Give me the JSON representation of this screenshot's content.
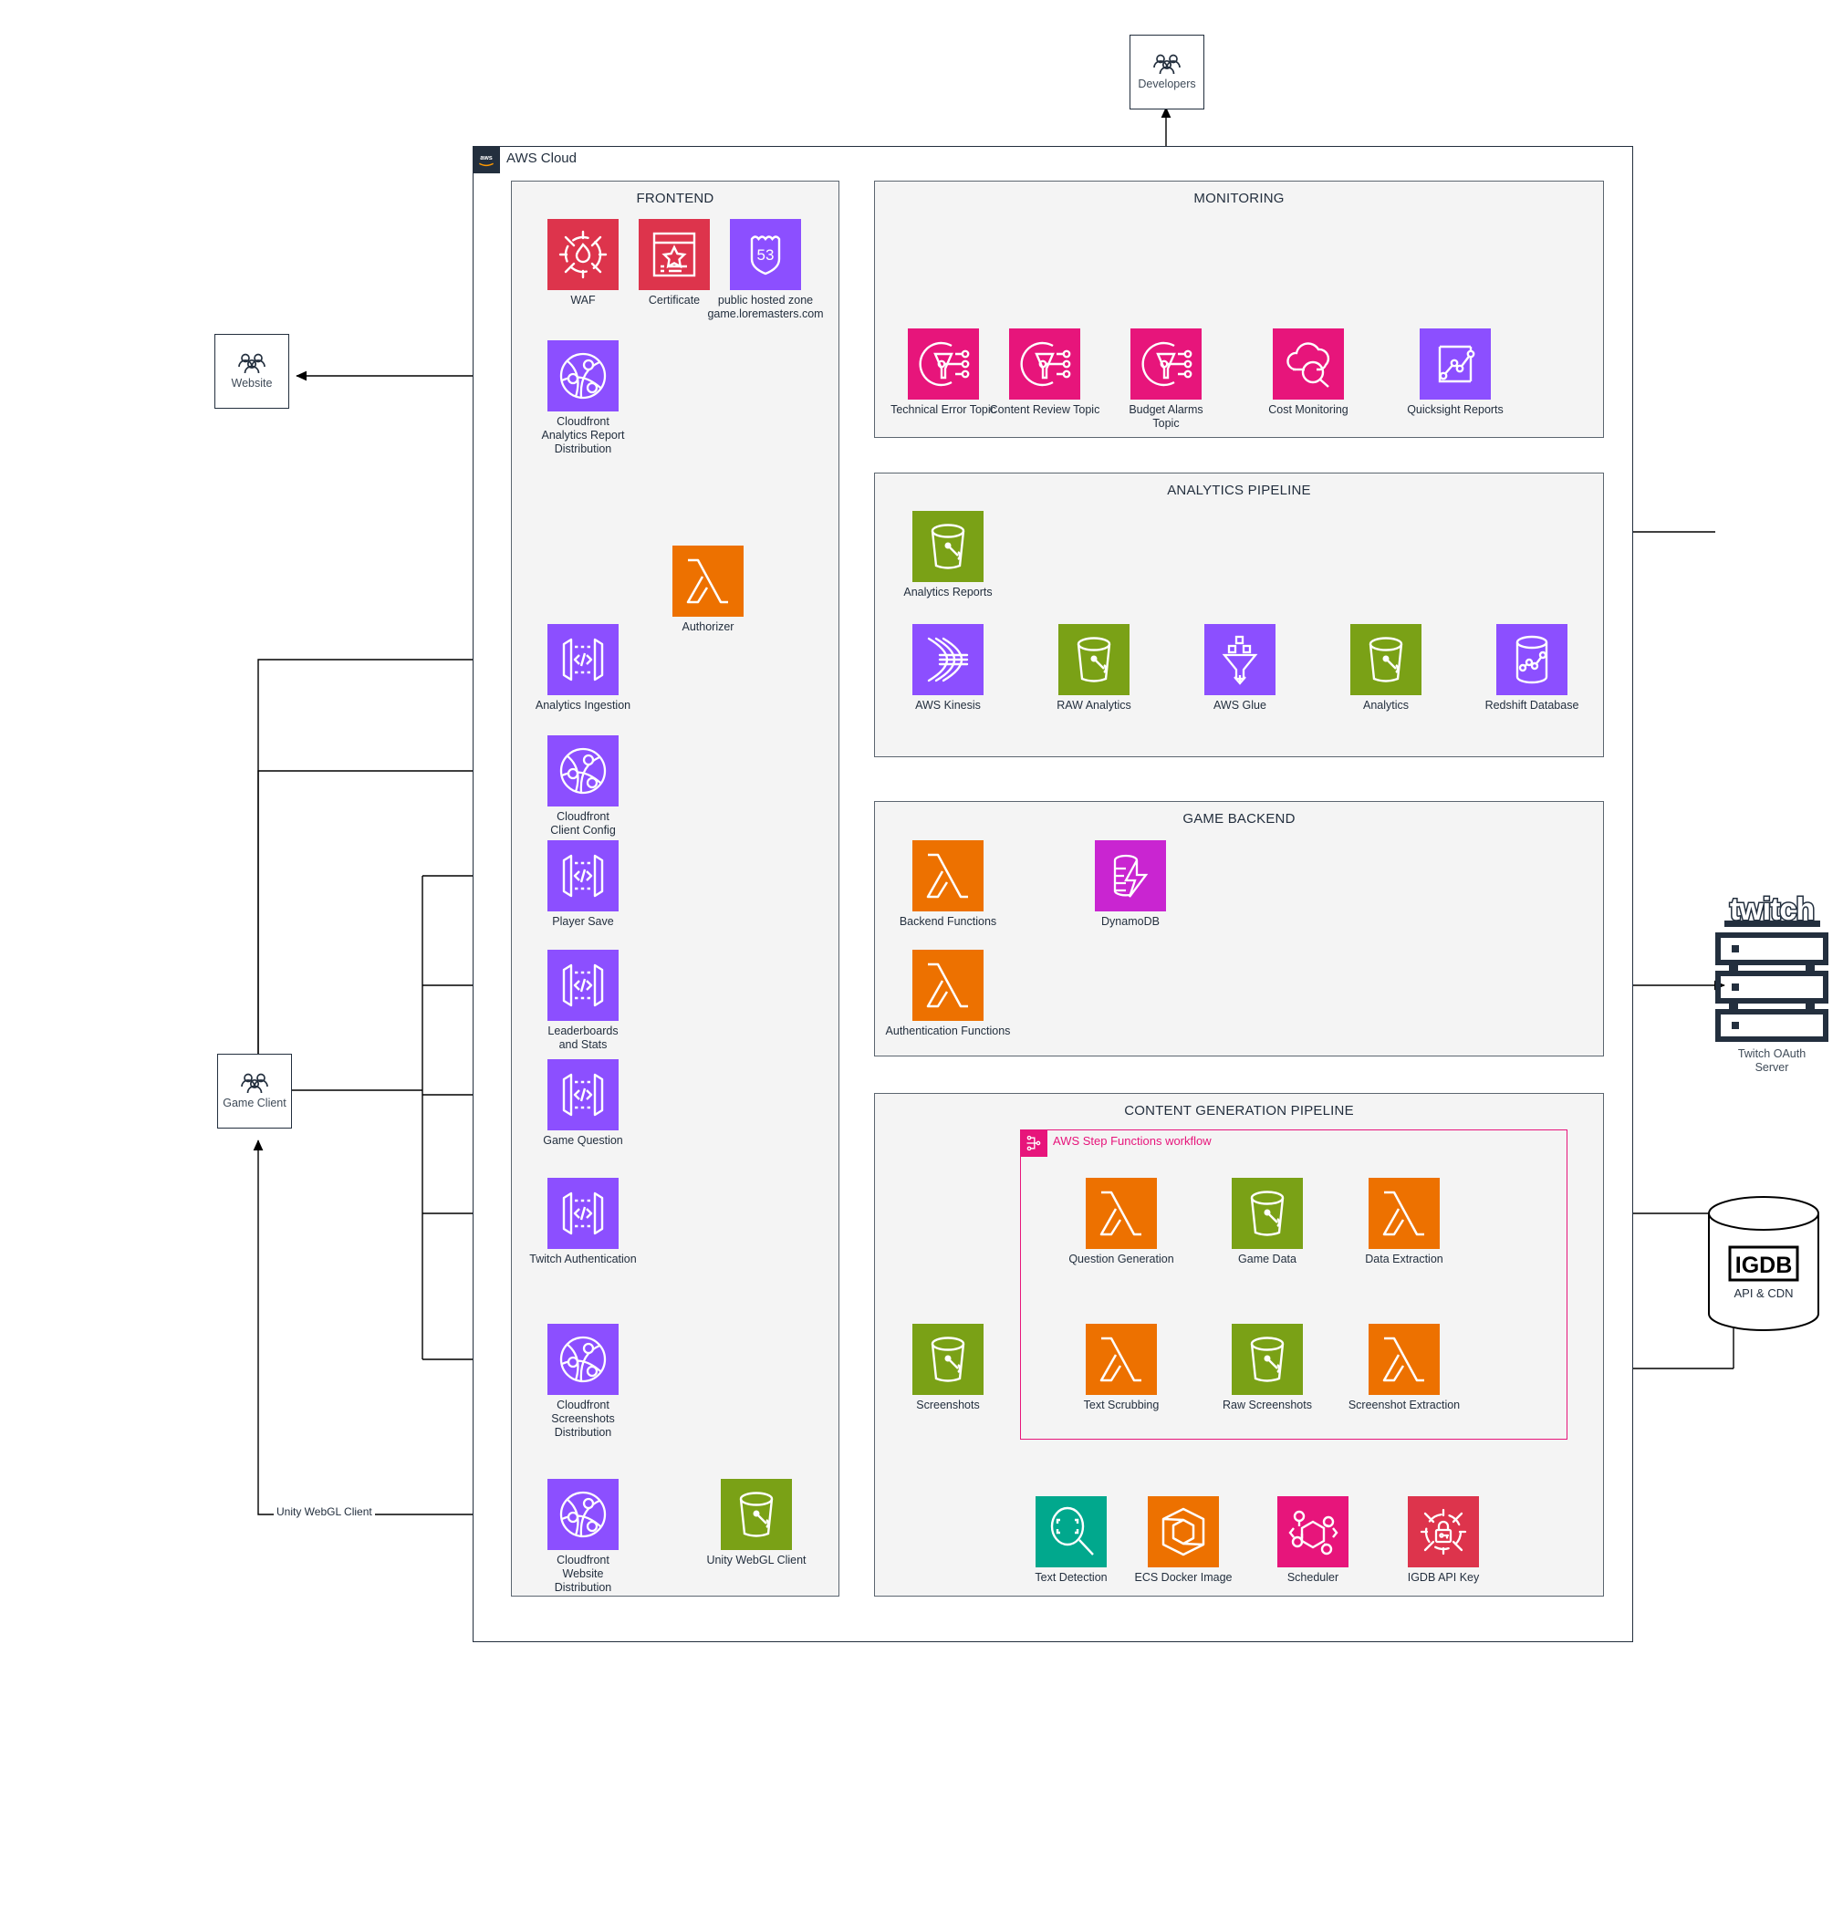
{
  "diagram": {
    "title": "AWS Cloud",
    "cloud_label": "AWS Cloud",
    "groups": [
      {
        "id": "frontend",
        "label": "FRONTEND"
      },
      {
        "id": "monitoring",
        "label": "MONITORING"
      },
      {
        "id": "analytics",
        "label": "ANALYTICS PIPELINE"
      },
      {
        "id": "game_backend",
        "label": "GAME BACKEND"
      },
      {
        "id": "content_pipeline",
        "label": "CONTENT GENERATION PIPELINE"
      }
    ],
    "stepfunctions": {
      "label": "AWS Step Functions workflow",
      "color": "#e7157b"
    }
  },
  "external": {
    "developers": {
      "label": "Developers",
      "icon": "users-icon"
    },
    "website": {
      "label": "Website",
      "icon": "users-icon"
    },
    "game_client": {
      "label": "Game Client",
      "icon": "users-icon"
    },
    "twitch": {
      "label": "Twitch OAuth\nServer",
      "wordmark": "twitch",
      "icon": "server-stack-icon"
    },
    "igdb": {
      "label": "API & CDN",
      "wordmark": "IGDB",
      "icon": "database-cylinder-icon"
    }
  },
  "edge_labels": {
    "unity_webgl_client": "Unity WebGL Client"
  },
  "colors": {
    "aws_navy": "#232f3e",
    "security_red": "#dd344c",
    "networking_purple": "#8c4fff",
    "storage_green": "#7aa116",
    "compute_orange": "#ed7100",
    "database_magenta": "#c925d1",
    "app_integration_pink": "#e7157b",
    "ml_teal": "#01a88d",
    "group_bg": "#f4f4f4",
    "group_border": "#5c6670"
  },
  "nodes": {
    "frontend": [
      {
        "id": "waf",
        "label": "WAF",
        "icon": "waf-icon",
        "color": "#dd344c"
      },
      {
        "id": "certificate",
        "label": "Certificate",
        "icon": "certificate-icon",
        "color": "#dd344c"
      },
      {
        "id": "hosted_zone",
        "label": "public hosted zone\ngame.loremasters.com",
        "icon": "route53-icon",
        "color": "#8c4fff"
      },
      {
        "id": "cf_analytics_report",
        "label": "Cloudfront\nAnalytics Report\nDistribution",
        "icon": "cloudfront-icon",
        "color": "#8c4fff"
      },
      {
        "id": "analytics_ingestion",
        "label": "Analytics Ingestion",
        "icon": "api-gateway-icon",
        "color": "#8c4fff"
      },
      {
        "id": "authorizer",
        "label": "Authorizer",
        "icon": "lambda-icon",
        "color": "#ed7100"
      },
      {
        "id": "cf_client_config",
        "label": "Cloudfront\nClient Config",
        "icon": "cloudfront-icon",
        "color": "#8c4fff"
      },
      {
        "id": "player_save",
        "label": "Player Save",
        "icon": "api-gateway-icon",
        "color": "#8c4fff"
      },
      {
        "id": "leaderboards",
        "label": "Leaderboards\nand Stats",
        "icon": "api-gateway-icon",
        "color": "#8c4fff"
      },
      {
        "id": "game_question",
        "label": "Game Question",
        "icon": "api-gateway-icon",
        "color": "#8c4fff"
      },
      {
        "id": "twitch_authentication",
        "label": "Twitch Authentication",
        "icon": "api-gateway-icon",
        "color": "#8c4fff"
      },
      {
        "id": "cf_screenshots",
        "label": "Cloudfront\nScreenshots\nDistribution",
        "icon": "cloudfront-icon",
        "color": "#8c4fff"
      },
      {
        "id": "cf_website",
        "label": "Cloudfront\nWebsite\nDistribution",
        "icon": "cloudfront-icon",
        "color": "#8c4fff"
      },
      {
        "id": "unity_webgl_bucket",
        "label": "Unity WebGL Client",
        "icon": "s3-bucket-icon",
        "color": "#7aa116"
      }
    ],
    "monitoring": [
      {
        "id": "technical_error_topic",
        "label": "Technical Error Topic",
        "icon": "sns-topic-icon",
        "color": "#e7157b"
      },
      {
        "id": "content_review_topic",
        "label": "Content Review Topic",
        "icon": "sns-topic-icon",
        "color": "#e7157b"
      },
      {
        "id": "budget_alarms_topic",
        "label": "Budget Alarms\nTopic",
        "icon": "sns-topic-icon",
        "color": "#e7157b"
      },
      {
        "id": "cost_monitoring",
        "label": "Cost Monitoring",
        "icon": "cost-explorer-icon",
        "color": "#e7157b"
      },
      {
        "id": "quicksight_reports",
        "label": "Quicksight Reports",
        "icon": "quicksight-icon",
        "color": "#8c4fff"
      }
    ],
    "analytics": [
      {
        "id": "analytics_reports",
        "label": "Analytics Reports",
        "icon": "s3-bucket-icon",
        "color": "#7aa116"
      },
      {
        "id": "aws_kinesis",
        "label": "AWS Kinesis",
        "icon": "kinesis-icon",
        "color": "#8c4fff"
      },
      {
        "id": "raw_analytics",
        "label": "RAW Analytics",
        "icon": "s3-bucket-icon",
        "color": "#7aa116"
      },
      {
        "id": "aws_glue",
        "label": "AWS Glue",
        "icon": "glue-icon",
        "color": "#8c4fff"
      },
      {
        "id": "analytics_bucket",
        "label": "Analytics",
        "icon": "s3-bucket-icon",
        "color": "#7aa116"
      },
      {
        "id": "redshift_database",
        "label": "Redshift Database",
        "icon": "redshift-icon",
        "color": "#8c4fff"
      }
    ],
    "game_backend": [
      {
        "id": "backend_functions",
        "label": "Backend Functions",
        "icon": "lambda-icon",
        "color": "#ed7100"
      },
      {
        "id": "dynamodb",
        "label": "DynamoDB",
        "icon": "dynamodb-icon",
        "color": "#c925d1"
      },
      {
        "id": "authentication_functions",
        "label": "Authentication Functions",
        "icon": "lambda-icon",
        "color": "#ed7100"
      }
    ],
    "content_pipeline": [
      {
        "id": "question_generation",
        "label": "Question Generation",
        "icon": "lambda-icon",
        "color": "#ed7100"
      },
      {
        "id": "game_data",
        "label": "Game Data",
        "icon": "s3-bucket-icon",
        "color": "#7aa116"
      },
      {
        "id": "data_extraction",
        "label": "Data Extraction",
        "icon": "lambda-icon",
        "color": "#ed7100"
      },
      {
        "id": "screenshots",
        "label": "Screenshots",
        "icon": "s3-bucket-icon",
        "color": "#7aa116"
      },
      {
        "id": "text_scrubbing",
        "label": "Text Scrubbing",
        "icon": "lambda-icon",
        "color": "#ed7100"
      },
      {
        "id": "raw_screenshots",
        "label": "Raw Screenshots",
        "icon": "s3-bucket-icon",
        "color": "#7aa116"
      },
      {
        "id": "screenshot_extraction",
        "label": "Screenshot Extraction",
        "icon": "lambda-icon",
        "color": "#ed7100"
      },
      {
        "id": "text_detection",
        "label": "Text Detection",
        "icon": "rekognition-icon",
        "color": "#01a88d"
      },
      {
        "id": "ecs_docker_image",
        "label": "ECS Docker Image",
        "icon": "ecr-icon",
        "color": "#ed7100"
      },
      {
        "id": "scheduler",
        "label": "Scheduler",
        "icon": "eventbridge-scheduler-icon",
        "color": "#e7157b"
      },
      {
        "id": "igdb_api_key",
        "label": "IGDB API Key",
        "icon": "secrets-manager-icon",
        "color": "#dd344c"
      }
    ]
  }
}
